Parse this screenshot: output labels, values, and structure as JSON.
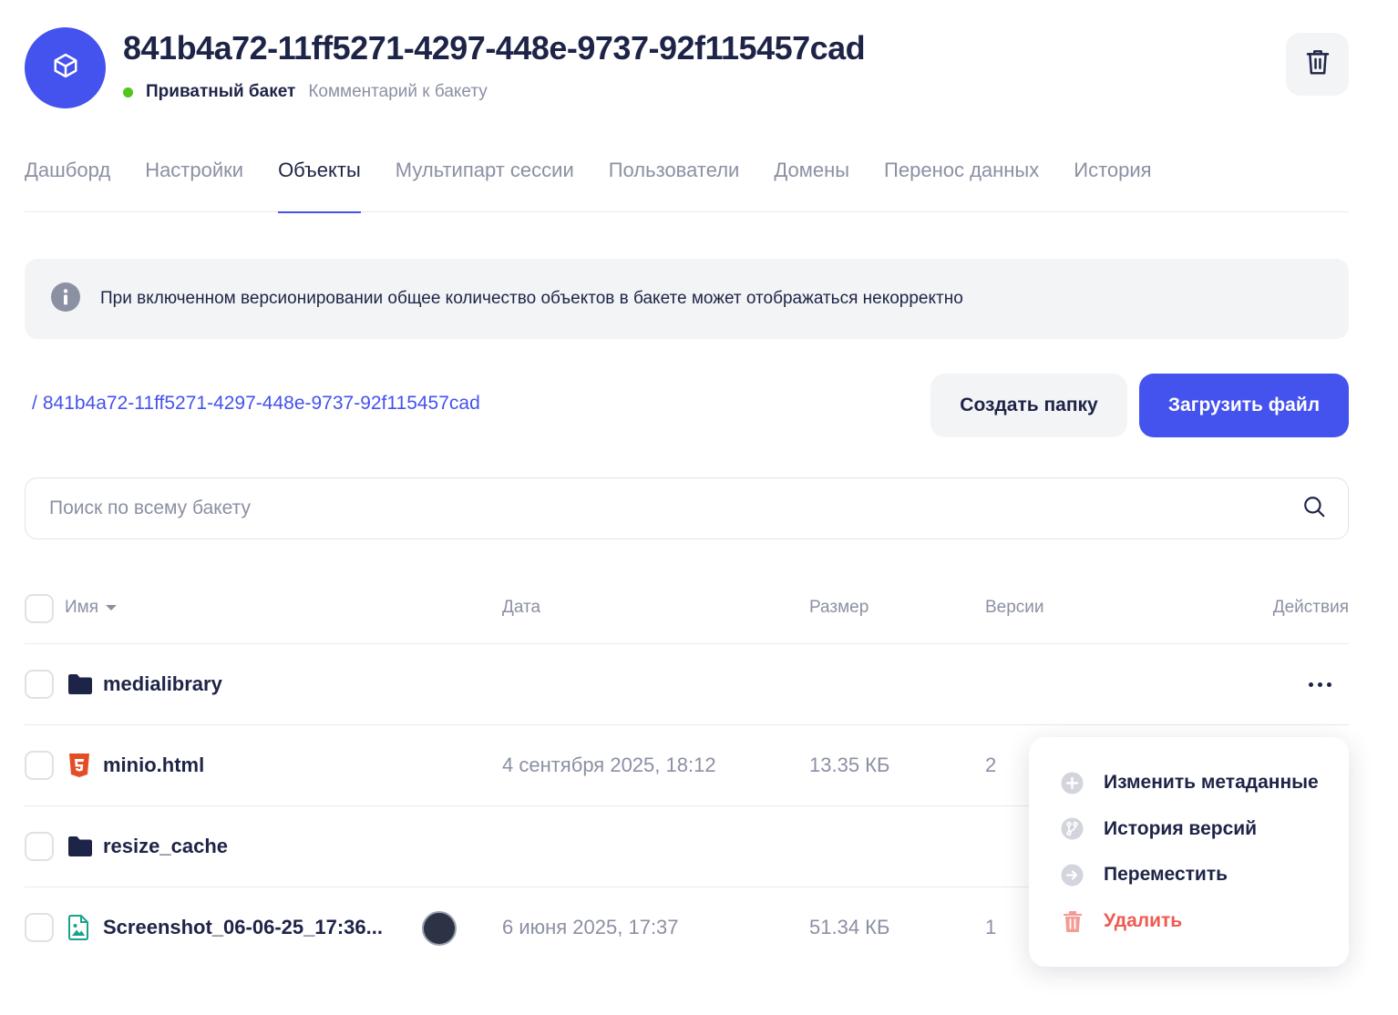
{
  "header": {
    "bucket_name": "841b4a72-11ff5271-4297-448e-9737-92f115457cad",
    "status": "Приватный бакет",
    "comment": "Комментарий к бакету"
  },
  "tabs": [
    {
      "label": "Дашборд"
    },
    {
      "label": "Настройки"
    },
    {
      "label": "Объекты",
      "active": true
    },
    {
      "label": "Мультипарт сессии"
    },
    {
      "label": "Пользователи"
    },
    {
      "label": "Домены"
    },
    {
      "label": "Перенос данных"
    },
    {
      "label": "История"
    }
  ],
  "notice": {
    "text": "При включенном версионировании общее количество объектов в бакете может отображаться некорректно"
  },
  "breadcrumb": {
    "separator": "/",
    "path": "841b4a72-11ff5271-4297-448e-9737-92f115457cad"
  },
  "actions": {
    "create_folder": "Создать папку",
    "upload_file": "Загрузить файл"
  },
  "search": {
    "placeholder": "Поиск по всему бакету",
    "value": ""
  },
  "table": {
    "columns": {
      "name": "Имя",
      "date": "Дата",
      "size": "Размер",
      "versions": "Версии",
      "actions": "Действия"
    },
    "rows": [
      {
        "type": "folder",
        "icon": "folder-icon",
        "name": "medialibrary",
        "date": "",
        "size": "",
        "versions": ""
      },
      {
        "type": "html",
        "icon": "html5-icon",
        "name": "minio.html",
        "date": "4 сентября 2025, 18:12",
        "size": "13.35 КБ",
        "versions": "2"
      },
      {
        "type": "folder",
        "icon": "folder-icon",
        "name": "resize_cache",
        "date": "",
        "size": "",
        "versions": ""
      },
      {
        "type": "image",
        "icon": "image-file-icon",
        "name": "Screenshot_06-06-25_17:36...",
        "date": "6 июня 2025, 17:37",
        "size": "51.34 КБ",
        "versions": "1"
      }
    ]
  },
  "context_menu": {
    "items": [
      {
        "label": "Изменить метаданные",
        "icon": "plus-circle-icon"
      },
      {
        "label": "История версий",
        "icon": "branch-icon"
      },
      {
        "label": "Переместить",
        "icon": "arrow-right-circle-icon"
      },
      {
        "label": "Удалить",
        "icon": "trash-icon",
        "danger": true
      }
    ]
  },
  "colors": {
    "accent": "#4452ee",
    "text": "#1e2447",
    "muted": "#8b90a3",
    "status_ok": "#52c41a",
    "danger": "#ef5a52",
    "html_icon": "#e44d26",
    "image_icon": "#1aa38a"
  }
}
